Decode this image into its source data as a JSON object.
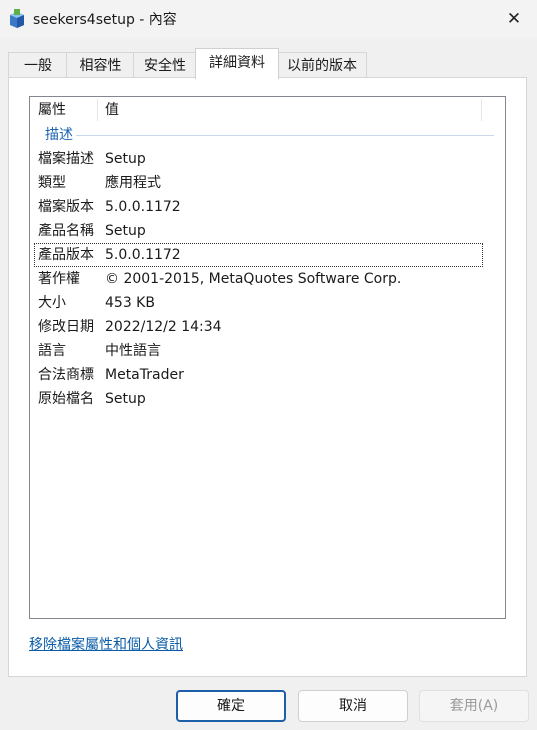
{
  "window": {
    "title": "seekers4setup - 內容",
    "app_icon": "setup-package-icon",
    "close_icon": "✕"
  },
  "tabs": [
    {
      "label": "一般"
    },
    {
      "label": "相容性"
    },
    {
      "label": "安全性"
    },
    {
      "label": "詳細資料",
      "active": true
    },
    {
      "label": "以前的版本"
    }
  ],
  "details": {
    "columns": {
      "property": "屬性",
      "value": "值"
    },
    "group": "描述",
    "rows": [
      {
        "key": "檔案描述",
        "value": "Setup"
      },
      {
        "key": "類型",
        "value": "應用程式"
      },
      {
        "key": "檔案版本",
        "value": "5.0.0.1172"
      },
      {
        "key": "產品名稱",
        "value": "Setup"
      },
      {
        "key": "產品版本",
        "value": "5.0.0.1172",
        "selected": true
      },
      {
        "key": "著作權",
        "value": "© 2001-2015, MetaQuotes Software Corp."
      },
      {
        "key": "大小",
        "value": "453 KB"
      },
      {
        "key": "修改日期",
        "value": "2022/12/2 14:34"
      },
      {
        "key": "語言",
        "value": "中性語言"
      },
      {
        "key": "合法商標",
        "value": "MetaTrader"
      },
      {
        "key": "原始檔名",
        "value": "Setup"
      }
    ]
  },
  "link": {
    "label": "移除檔案屬性和個人資訊"
  },
  "buttons": {
    "ok": "確定",
    "cancel": "取消",
    "apply": "套用(A)"
  },
  "colors": {
    "accent": "#1c5fa8",
    "link": "#0a5ca8",
    "group_header": "#1d64b3"
  }
}
